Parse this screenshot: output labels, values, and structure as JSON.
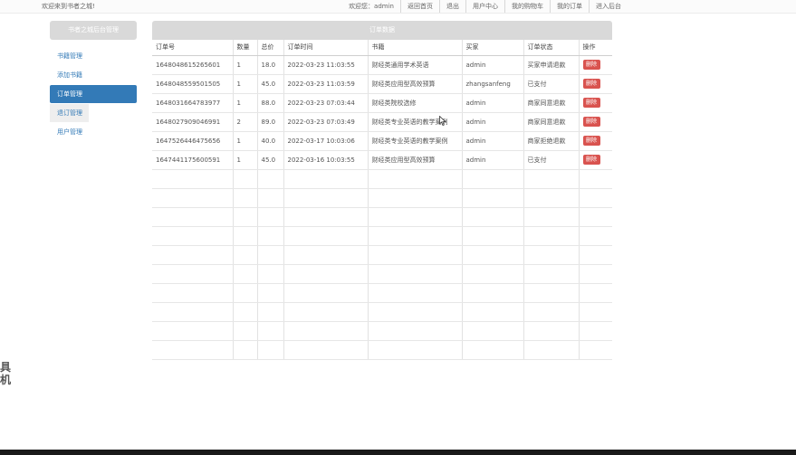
{
  "topbar": {
    "welcome": "欢迎来到书者之城!",
    "links": [
      "欢迎您：admin",
      "返回首页",
      "退出",
      "用户中心",
      "我的购物车",
      "我的订单",
      "进入后台"
    ]
  },
  "sidebar": {
    "title": "书者之城后台管理",
    "items": [
      "书籍管理",
      "添加书籍",
      "订单管理",
      "退订管理",
      "用户管理"
    ],
    "active_index": 2
  },
  "panel": {
    "title": "订单数据",
    "headers": [
      "订单号",
      "数量",
      "总价",
      "订单时间",
      "书籍",
      "买家",
      "订单状态",
      "操作"
    ],
    "delete_label": "删除",
    "rows": [
      [
        "1648048615265601",
        "1",
        "18.0",
        "2022-03-23 11:03:55",
        "财经类通用学术英语",
        "admin",
        "买家申请退款"
      ],
      [
        "1648048559501505",
        "1",
        "45.0",
        "2022-03-23 11:03:59",
        "财经类应用型高效预算",
        "zhangsanfeng",
        "已支付"
      ],
      [
        "1648031664783977",
        "1",
        "88.0",
        "2022-03-23 07:03:44",
        "财经类院校选修",
        "admin",
        "商家同意退款"
      ],
      [
        "1648027909046991",
        "2",
        "89.0",
        "2022-03-23 07:03:49",
        "财经类专业英语的教学案例",
        "admin",
        "商家同意退款"
      ],
      [
        "1647526446475656",
        "1",
        "40.0",
        "2022-03-17 10:03:06",
        "财经类专业英语的教学案例",
        "admin",
        "商家拒绝退款"
      ],
      [
        "1647441175600591",
        "1",
        "45.0",
        "2022-03-16 10:03:55",
        "财经类应用型高效预算",
        "admin",
        "已支付"
      ]
    ]
  },
  "watermark": "具\n机"
}
